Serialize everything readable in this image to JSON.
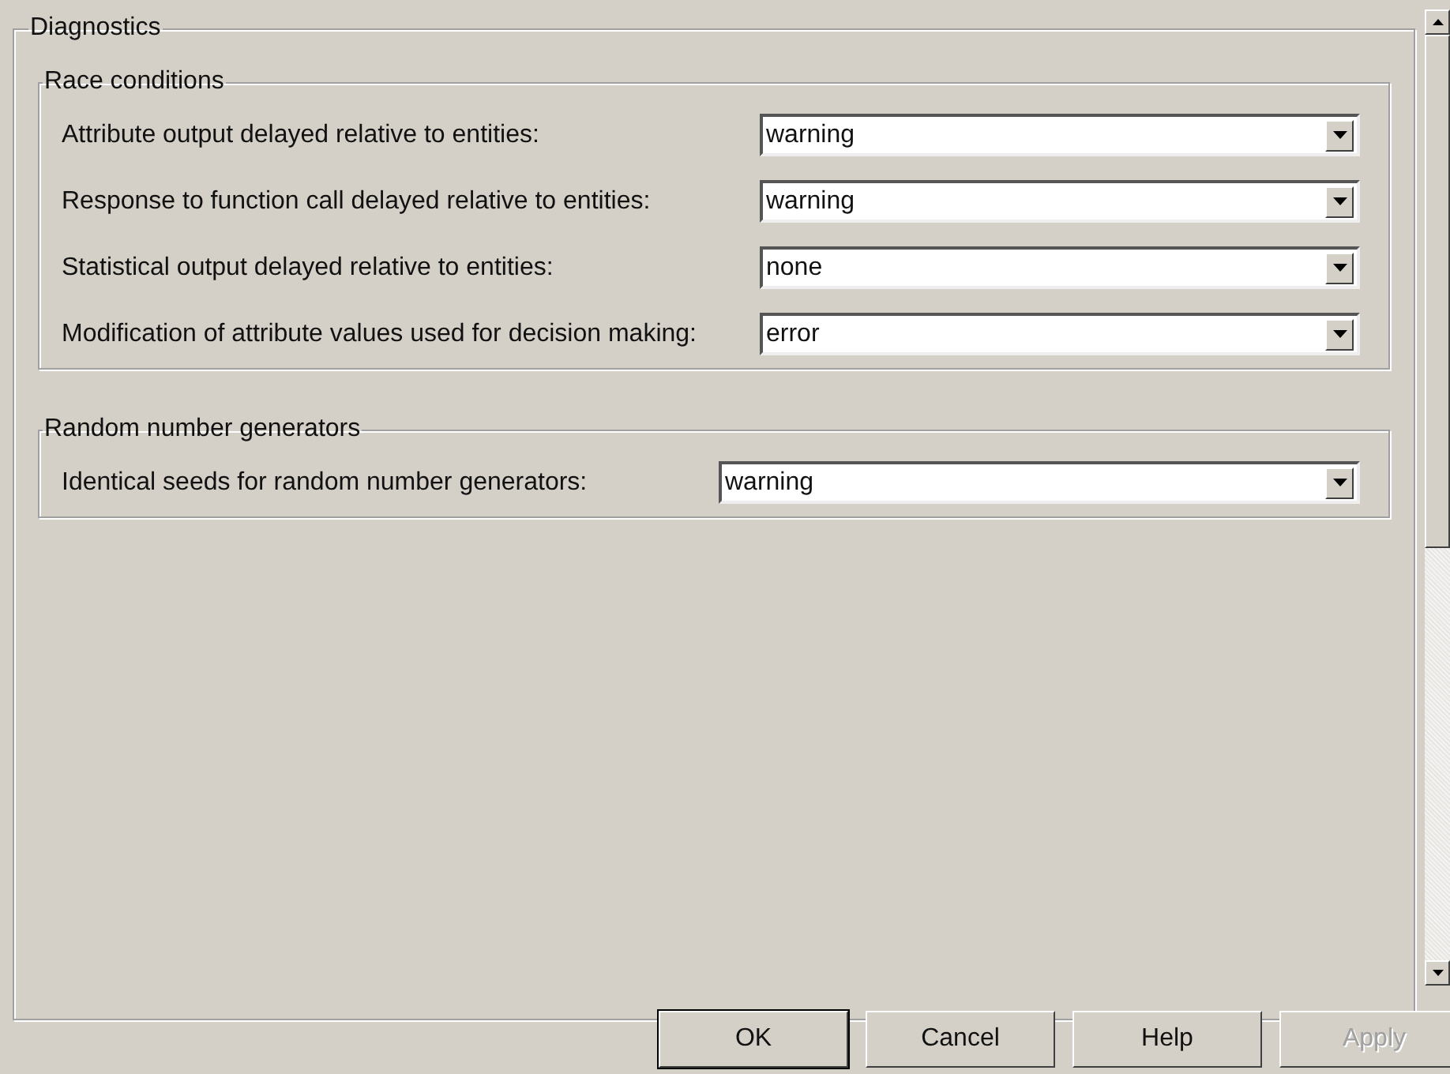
{
  "panel": {
    "title": "Diagnostics",
    "groups": [
      {
        "title": "Race conditions",
        "rows": [
          {
            "label": "Attribute output delayed relative to entities:",
            "value": "warning"
          },
          {
            "label": "Response to function call delayed relative to entities:",
            "value": "warning"
          },
          {
            "label": "Statistical output delayed relative to entities:",
            "value": "none"
          },
          {
            "label": "Modification of attribute values used for decision making:",
            "value": "error"
          }
        ]
      },
      {
        "title": "Random number generators",
        "rows": [
          {
            "label": "Identical seeds for random number generators:",
            "value": "warning"
          }
        ]
      }
    ]
  },
  "buttons": [
    {
      "label": "OK",
      "default": true,
      "disabled": false
    },
    {
      "label": "Cancel",
      "default": false,
      "disabled": false
    },
    {
      "label": "Help",
      "default": false,
      "disabled": false
    },
    {
      "label": "Apply",
      "default": false,
      "disabled": true
    }
  ]
}
